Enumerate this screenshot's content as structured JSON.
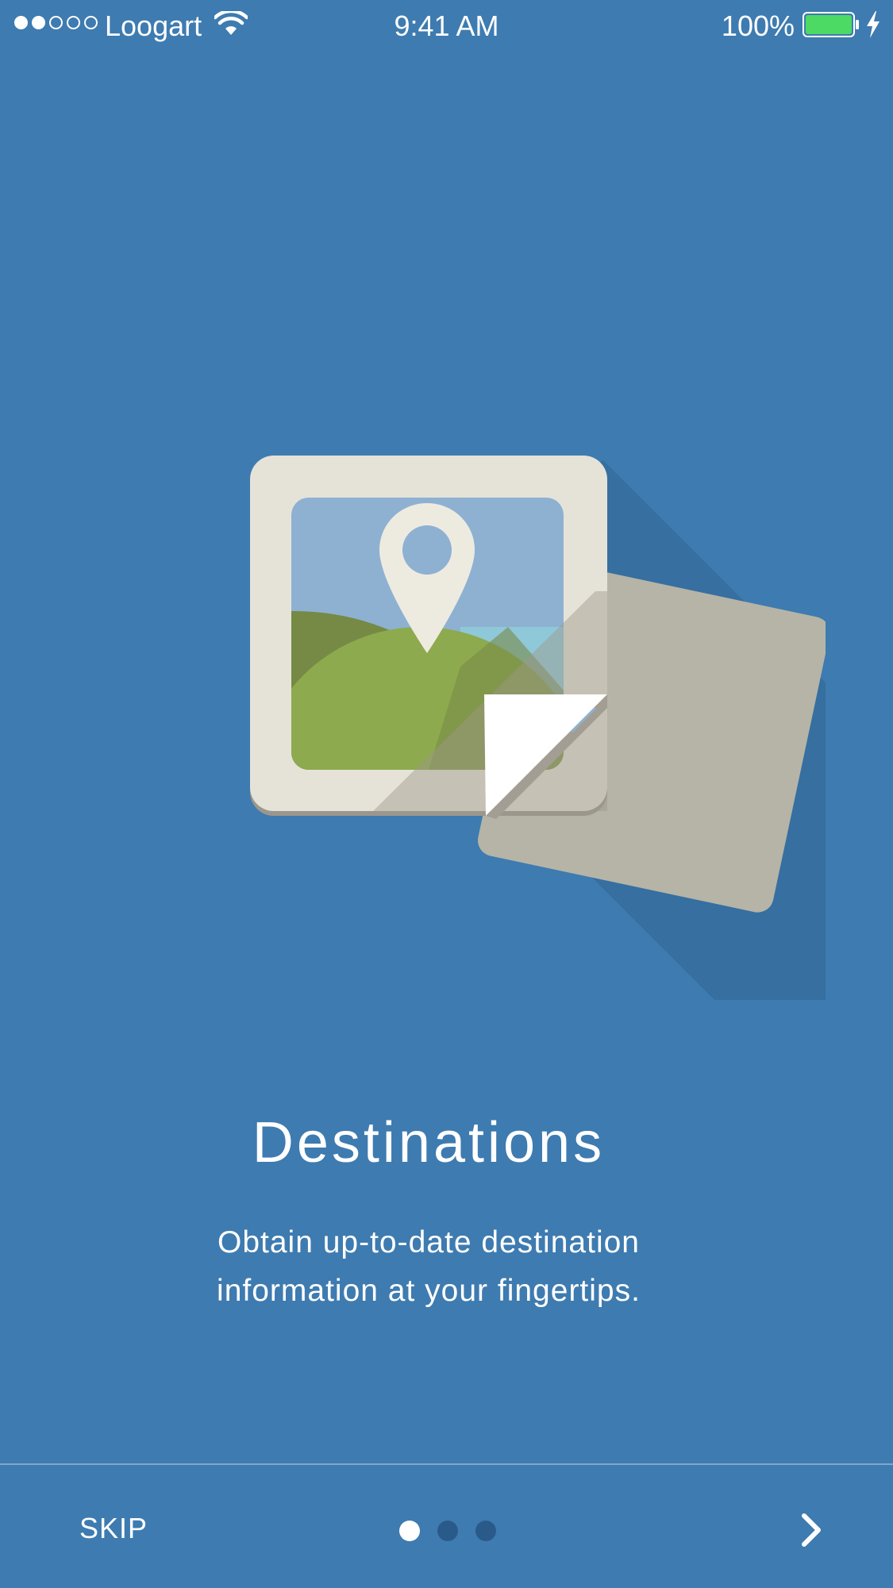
{
  "status_bar": {
    "carrier": "Loogart",
    "time": "9:41 AM",
    "battery_percent": "100%",
    "signal_bars_filled": 2,
    "signal_bars_total": 5
  },
  "onboarding": {
    "illustration_icon": "photo-location-icon",
    "title": "Destinations",
    "subtitle_line1": "Obtain up-to-date destination",
    "subtitle_line2": "information at your fingertips."
  },
  "footer": {
    "skip_label": "SKIP",
    "page_indicator": {
      "current": 1,
      "total": 3
    },
    "next_icon": "chevron-right-icon"
  },
  "colors": {
    "background": "#3E7BB0",
    "battery_fill": "#4CD964",
    "indicator_inactive": "#2A5A8A",
    "indicator_active": "#FFFFFF"
  }
}
